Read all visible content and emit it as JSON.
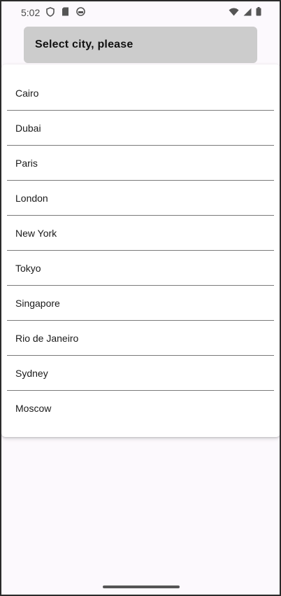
{
  "status_bar": {
    "time": "5:02",
    "left_icons": [
      "shield-icon",
      "sd-card-icon",
      "android-face-icon"
    ],
    "right_icons": [
      "wifi-icon",
      "cellular-signal-icon",
      "battery-icon"
    ]
  },
  "select": {
    "label": "Select city, please"
  },
  "dropdown": {
    "items": [
      {
        "label": "Cairo"
      },
      {
        "label": "Dubai"
      },
      {
        "label": "Paris"
      },
      {
        "label": "London"
      },
      {
        "label": "New York"
      },
      {
        "label": "Tokyo"
      },
      {
        "label": "Singapore"
      },
      {
        "label": "Rio de Janeiro"
      },
      {
        "label": "Sydney"
      },
      {
        "label": "Moscow"
      }
    ]
  },
  "colors": {
    "select_background": "#cccccc",
    "panel_background": "#ffffff",
    "divider": "#7a7a7a",
    "page_background": "#fcf9fd"
  }
}
